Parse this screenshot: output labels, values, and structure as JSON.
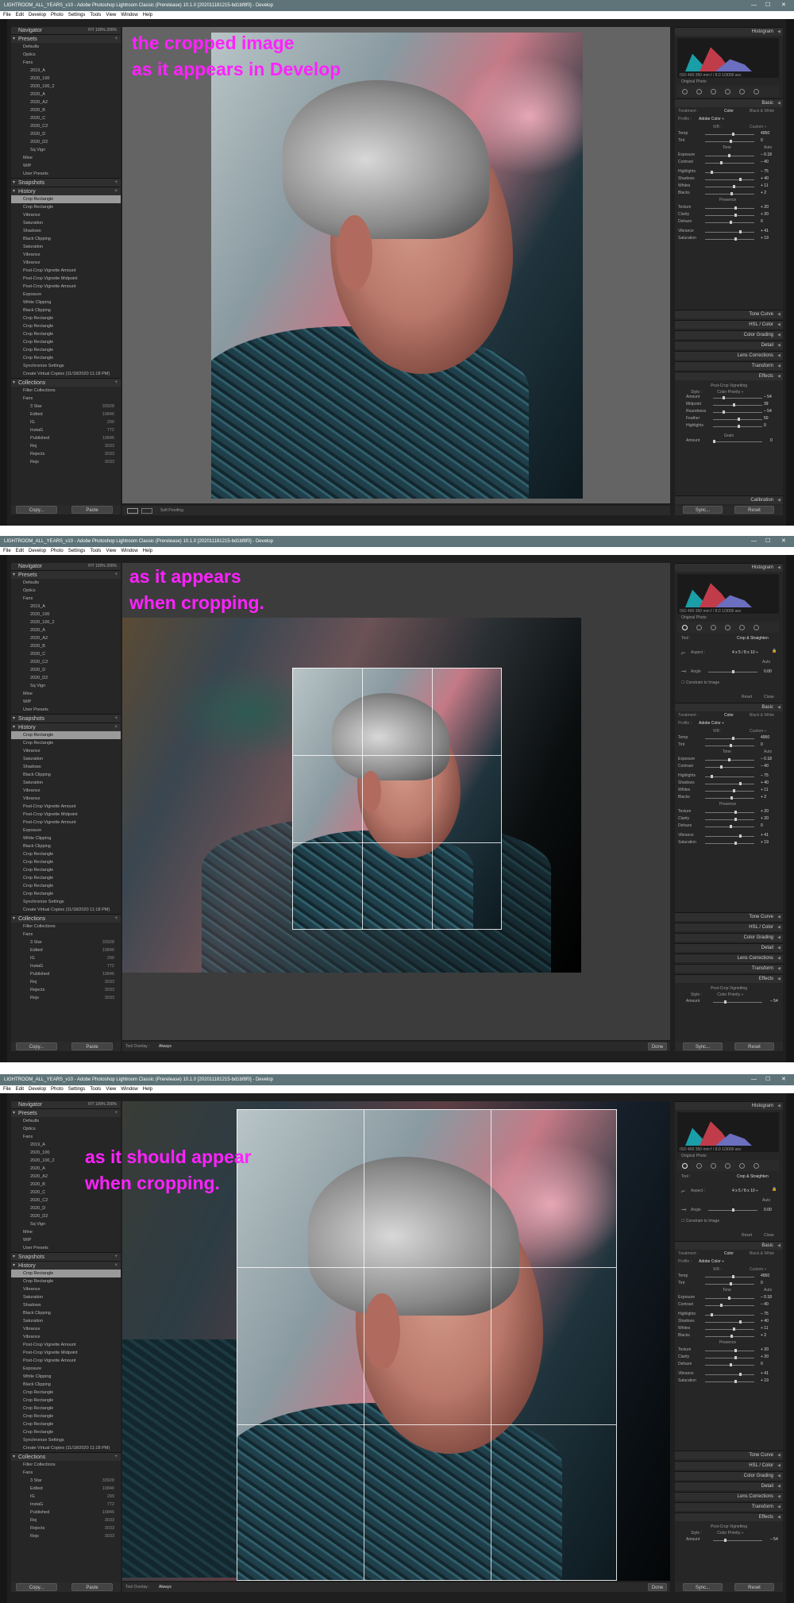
{
  "window": {
    "title": "LIGHTROOM_ALL_YEARS_v10 - Adobe Photoshop Lightroom Classic (Prerelease) 10.1.0 [202011181215-bd1bf8f0] - Develop",
    "min": "—",
    "max": "☐",
    "close": "✕"
  },
  "menu": [
    "File",
    "Edit",
    "Develop",
    "Photo",
    "Settings",
    "Tools",
    "View",
    "Window",
    "Help"
  ],
  "navigator": {
    "label": "Navigator",
    "zoom": "FIT  100%  200%"
  },
  "presets": {
    "label": "Presets",
    "items": [
      {
        "label": "Defaults",
        "indent": false
      },
      {
        "label": "Optics",
        "indent": false
      },
      {
        "label": "Fans",
        "indent": false
      },
      {
        "label": "2019_A",
        "indent": true
      },
      {
        "label": "2020_100",
        "indent": true
      },
      {
        "label": "2020_100_2",
        "indent": true
      },
      {
        "label": "2020_A",
        "indent": true
      },
      {
        "label": "2020_A2",
        "indent": true
      },
      {
        "label": "2020_B",
        "indent": true
      },
      {
        "label": "2020_C",
        "indent": true
      },
      {
        "label": "2020_C2",
        "indent": true
      },
      {
        "label": "2020_D",
        "indent": true
      },
      {
        "label": "2020_D2",
        "indent": true
      },
      {
        "label": "Sq Vign",
        "indent": true
      },
      {
        "label": "Mine",
        "indent": false
      },
      {
        "label": "WIP",
        "indent": false
      },
      {
        "label": "User Presets",
        "indent": false
      }
    ]
  },
  "snapshots": {
    "label": "Snapshots"
  },
  "history": {
    "label": "History",
    "items": [
      "Crop Rectangle",
      "Crop Rectangle",
      "Vibrance",
      "Saturation",
      "Shadows",
      "Black Clipping",
      "Saturation",
      "Vibrance",
      "Vibrance",
      "Post-Crop Vignette Amount",
      "Post-Crop Vignette Midpoint",
      "Post-Crop Vignette Amount",
      "Exposure",
      "White Clipping",
      "Black Clipping",
      "Crop Rectangle",
      "Crop Rectangle",
      "Crop Rectangle",
      "Crop Rectangle",
      "Crop Rectangle",
      "Crop Rectangle",
      "Synchronize Settings",
      "Create Virtual Copies (11/18/2020 11:18 PM)"
    ]
  },
  "collections": {
    "label": "Collections",
    "items": [
      {
        "label": "Filter Collections",
        "count": "",
        "indent": false
      },
      {
        "label": "Fans",
        "count": "",
        "indent": false
      },
      {
        "label": "3 Star",
        "count": "33928",
        "indent": true
      },
      {
        "label": "Edited",
        "count": "10846",
        "indent": true
      },
      {
        "label": "IG",
        "count": "299",
        "indent": true
      },
      {
        "label": "InstaG",
        "count": "772",
        "indent": true
      },
      {
        "label": "Published",
        "count": "10846",
        "indent": true
      },
      {
        "label": "Rej",
        "count": "3033",
        "indent": true
      },
      {
        "label": "Rejects",
        "count": "3033",
        "indent": true
      },
      {
        "label": "Rejs",
        "count": "3033",
        "indent": true
      }
    ]
  },
  "buttons": {
    "copy": "Copy...",
    "paste": "Paste",
    "sync": "Sync...",
    "reset": "Reset",
    "done": "Done",
    "close": "Close"
  },
  "toolbar": {
    "soft_proofing": "Soft Proofing",
    "tool_overlay": "Tool Overlay :",
    "overlay_value": "Always"
  },
  "histogram": {
    "label": "Histogram",
    "original_photo": "Original Photo",
    "info": "ISO 400    350 mm    f / 8.0    1/3000 sec"
  },
  "crop_panel": {
    "tool": "Tool :",
    "tool_name": "Crop & Straighten",
    "aspect": "Aspect :",
    "aspect_value": "4 x 5  /  8 x 10 ÷",
    "auto": "Auto",
    "angle": "Angle",
    "angle_value": "0.00",
    "constrain": "Constrain to Image"
  },
  "basic": {
    "label": "Basic",
    "treatment": "Treatment :",
    "color": "Color",
    "bw": "Black & White",
    "profile": "Profile :",
    "profile_value": "Adobe Color ÷",
    "wb": "WB :",
    "wb_value": "Custom ÷",
    "tone": "Tone",
    "tone_auto": "Auto",
    "presence": "Presence"
  },
  "sliders": [
    {
      "label": "Temp",
      "value": "4950",
      "pos": 0.55
    },
    {
      "label": "Tint",
      "value": "0",
      "pos": 0.5
    },
    {
      "label": "Exposure",
      "value": "– 0.18",
      "pos": 0.47
    },
    {
      "label": "Contrast",
      "value": "– 40",
      "pos": 0.3
    },
    {
      "label": "Highlights",
      "value": "– 75",
      "pos": 0.12
    },
    {
      "label": "Shadows",
      "value": "+ 40",
      "pos": 0.7
    },
    {
      "label": "Whites",
      "value": "+ 11",
      "pos": 0.56
    },
    {
      "label": "Blacks",
      "value": "+ 2",
      "pos": 0.51
    },
    {
      "label": "Texture",
      "value": "+ 20",
      "pos": 0.6
    },
    {
      "label": "Clarity",
      "value": "+ 20",
      "pos": 0.6
    },
    {
      "label": "Dehaze",
      "value": "0",
      "pos": 0.5
    },
    {
      "label": "Vibrance",
      "value": "+ 41",
      "pos": 0.7
    },
    {
      "label": "Saturation",
      "value": "+ 19",
      "pos": 0.6
    }
  ],
  "panels": [
    "Tone Curve",
    "HSL / Color",
    "Color Grading",
    "Detail",
    "Lens Corrections",
    "Transform",
    "Effects"
  ],
  "effects": {
    "vignette": "Post-Crop Vignetting",
    "style": "Style :",
    "style_value": "Color Priority ÷",
    "rows": [
      {
        "label": "Amount",
        "value": "– 54"
      },
      {
        "label": "Midpoint",
        "value": "39"
      },
      {
        "label": "Roundness",
        "value": "– 54"
      },
      {
        "label": "Feather",
        "value": "50"
      },
      {
        "label": "Highlights",
        "value": "0"
      }
    ],
    "grain": "Grain",
    "grain_amount": "Amount",
    "grain_value": "0",
    "calibration": "Calibration"
  },
  "annotations": {
    "a1": "the cropped image\nas it appears in Develop",
    "a2": "as it appears\nwhen cropping.",
    "a3": "as it should appear\nwhen cropping."
  },
  "colors": {
    "annotation": "#ff22ff",
    "titlebar": "#5e7478",
    "panel": "#262626"
  }
}
